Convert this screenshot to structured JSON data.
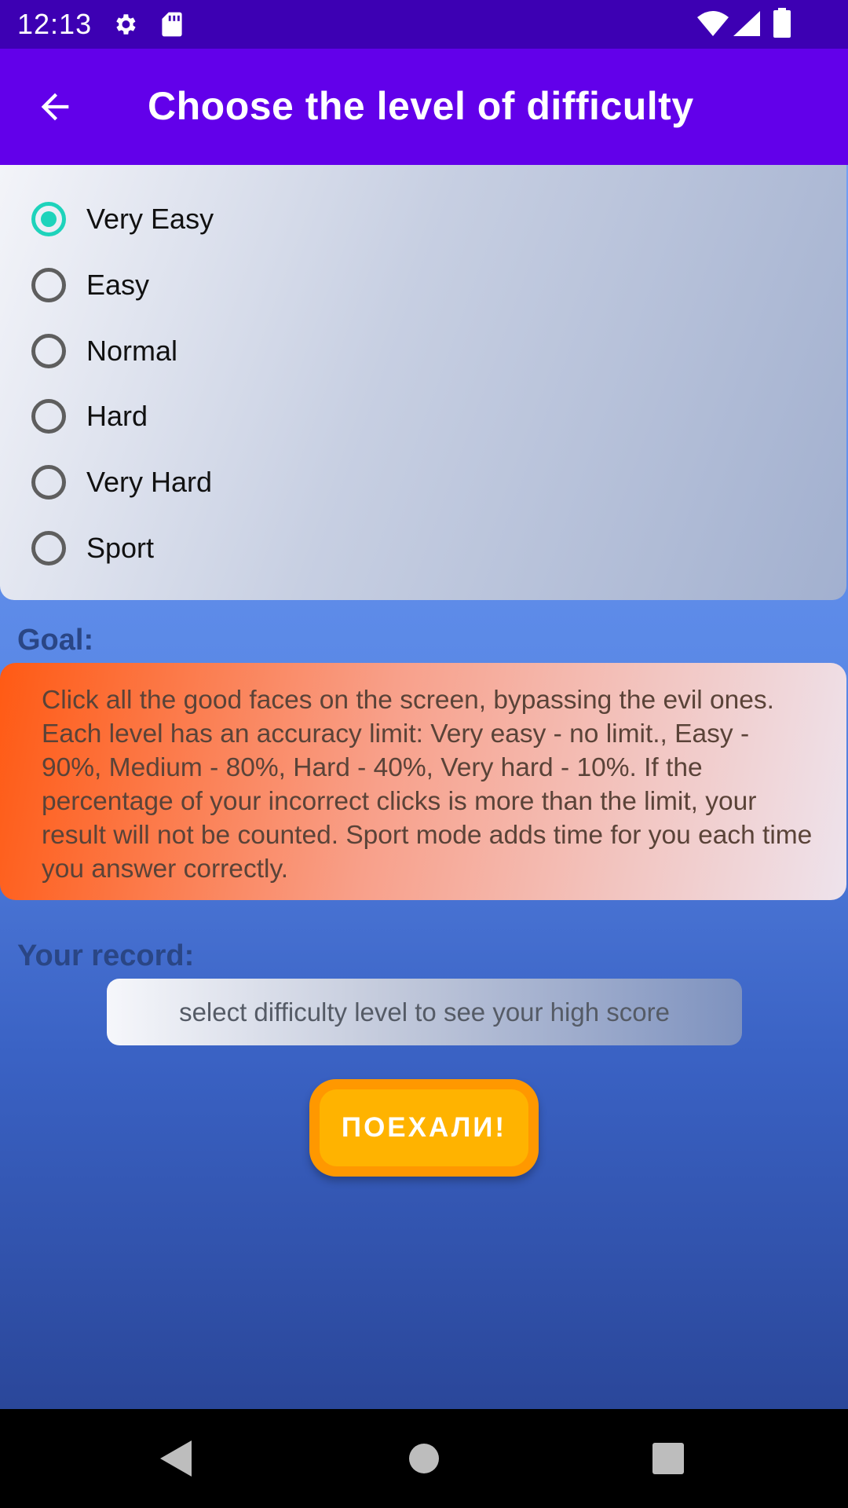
{
  "status_bar": {
    "time": "12:13",
    "icons": [
      "gear-icon",
      "sd-card-icon",
      "wifi-icon",
      "signal-icon",
      "battery-icon"
    ]
  },
  "app_bar": {
    "title": "Choose the level of difficulty",
    "back_icon": "arrow-left-icon"
  },
  "difficulty": {
    "options": [
      {
        "label": "Very Easy",
        "checked": true
      },
      {
        "label": "Easy",
        "checked": false
      },
      {
        "label": "Normal",
        "checked": false
      },
      {
        "label": "Hard",
        "checked": false
      },
      {
        "label": "Very Hard",
        "checked": false
      },
      {
        "label": "Sport",
        "checked": false
      }
    ]
  },
  "goal": {
    "label": "Goal:",
    "text": "Click all the good faces on the screen, bypassing the evil ones. Each level has an accuracy limit: Very easy - no limit., Easy - 90%, Medium - 80%, Hard - 40%, Very hard - 10%. If the percentage of your incorrect clicks is more than the limit, your result will not be counted. Sport mode adds time for you each time you answer correctly."
  },
  "record": {
    "label": "Your record:",
    "value": "select difficulty level to see your high score"
  },
  "start_button": {
    "label": "ПОЕХАЛИ!"
  },
  "nav_bar": {
    "icons": [
      "back-triangle-icon",
      "home-circle-icon",
      "recents-square-icon"
    ]
  },
  "colors": {
    "status_bar": "#3d00b3",
    "app_bar": "#6200ea",
    "radio_checked": "#1ed3bb",
    "button_outer": "#ff9800",
    "button_inner": "#ffb300"
  }
}
